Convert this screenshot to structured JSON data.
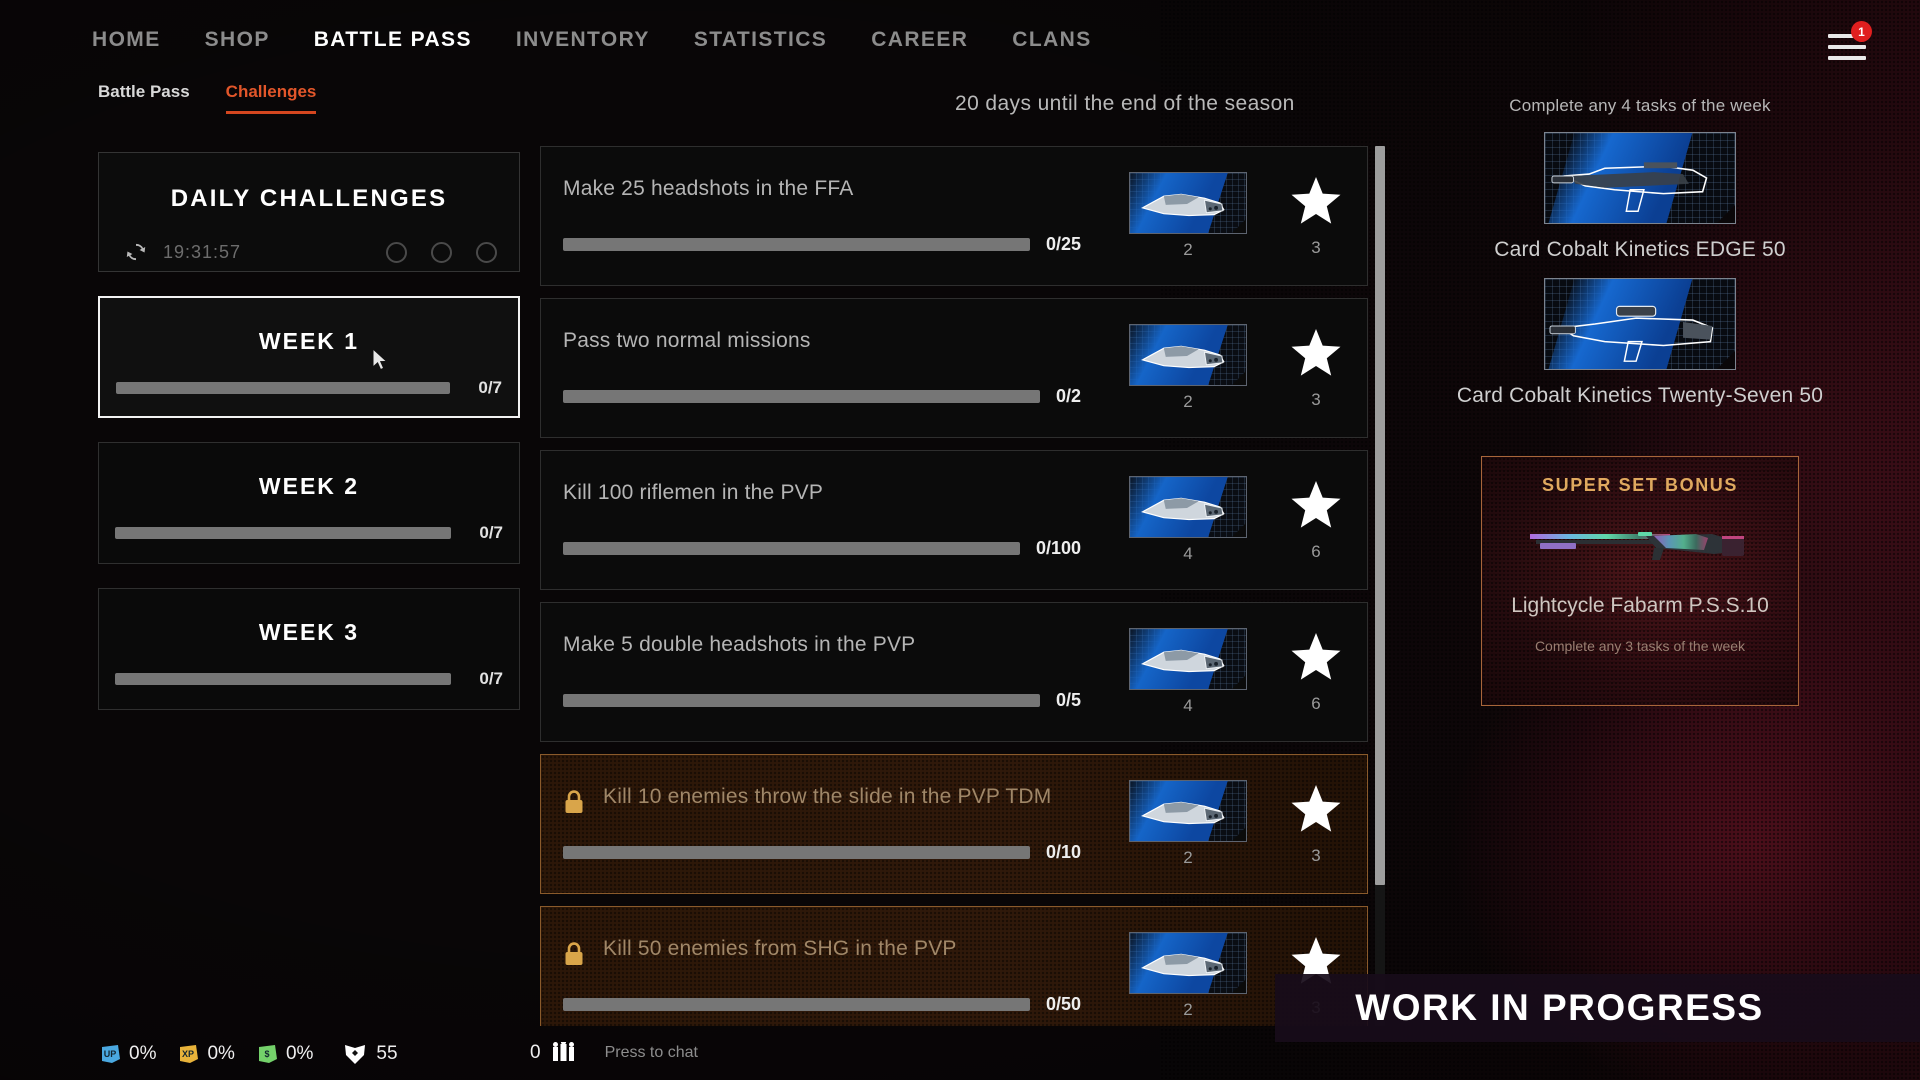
{
  "nav": {
    "items": [
      {
        "label": "HOME",
        "active": false
      },
      {
        "label": "SHOP",
        "active": false
      },
      {
        "label": "BATTLE PASS",
        "active": true
      },
      {
        "label": "INVENTORY",
        "active": false
      },
      {
        "label": "STATISTICS",
        "active": false
      },
      {
        "label": "CAREER",
        "active": false
      },
      {
        "label": "CLANS",
        "active": false
      }
    ],
    "menu_badge": "1",
    "menu_icon": "hamburger-menu-icon"
  },
  "subtabs": [
    {
      "label": "Battle Pass",
      "active": false
    },
    {
      "label": "Challenges",
      "active": true
    }
  ],
  "season": {
    "countdown_text": "20 days until the end of the season"
  },
  "daily": {
    "title": "DAILY CHALLENGES",
    "refresh_icon": "refresh-icon",
    "timer": "19:31:57",
    "slots": 3
  },
  "weeks": [
    {
      "label": "WEEK 1",
      "progress_text": "0/7",
      "percent": 0,
      "selected": true
    },
    {
      "label": "WEEK 2",
      "progress_text": "0/7",
      "percent": 0,
      "selected": false
    },
    {
      "label": "WEEK 3",
      "progress_text": "0/7",
      "percent": 0,
      "selected": false
    }
  ],
  "challenges": [
    {
      "text": "Make 25 headshots in the FFA",
      "progress_text": "0/25",
      "percent": 0,
      "locked": false,
      "card_reward": "2",
      "star_reward": "3",
      "card_icon": "knife-card-icon",
      "star_icon": "star-icon"
    },
    {
      "text": "Pass two normal missions",
      "progress_text": "0/2",
      "percent": 0,
      "locked": false,
      "card_reward": "2",
      "star_reward": "3",
      "card_icon": "knife-card-icon",
      "star_icon": "star-icon"
    },
    {
      "text": "Kill 100 riflemen in the PVP",
      "progress_text": "0/100",
      "percent": 0,
      "locked": false,
      "card_reward": "4",
      "star_reward": "6",
      "card_icon": "knife-card-icon",
      "star_icon": "star-icon"
    },
    {
      "text": "Make 5 double headshots in the PVP",
      "progress_text": "0/5",
      "percent": 0,
      "locked": false,
      "card_reward": "4",
      "star_reward": "6",
      "card_icon": "knife-card-icon",
      "star_icon": "star-icon"
    },
    {
      "text": "Kill 10 enemies throw the slide in the PVP TDM",
      "progress_text": "0/10",
      "percent": 0,
      "locked": true,
      "lock_icon": "lock-icon",
      "card_reward": "2",
      "star_reward": "3",
      "card_icon": "knife-card-icon",
      "star_icon": "star-icon"
    },
    {
      "text": "Kill 50 enemies from SHG in the PVP",
      "progress_text": "0/50",
      "percent": 0,
      "locked": true,
      "lock_icon": "lock-icon",
      "card_reward": "2",
      "star_reward": "3",
      "card_icon": "knife-card-icon",
      "star_icon": "star-icon"
    }
  ],
  "rewards": {
    "caption": "Complete any 4 tasks of the week",
    "items": [
      {
        "name": "Card Cobalt Kinetics EDGE 50",
        "icon": "rifle-card-icon"
      },
      {
        "name": "Card Cobalt Kinetics Twenty-Seven 50",
        "icon": "sniper-card-icon"
      }
    ],
    "superset": {
      "title": "SUPER SET BONUS",
      "weapon_name": "Lightcycle Fabarm P.S.S.10",
      "requirement": "Complete any 3 tasks of the week",
      "icon": "shotgun-icon"
    }
  },
  "statusbar": {
    "boosts": [
      {
        "icon": "up-boost-icon",
        "value": "0%",
        "color": "#4aa8e0"
      },
      {
        "icon": "xp-boost-icon",
        "value": "0%",
        "color": "#e8b33a"
      },
      {
        "icon": "money-boost-icon",
        "value": "0%",
        "color": "#74d16a"
      }
    ],
    "shield": {
      "icon": "shield-icon",
      "value": "55"
    },
    "players": {
      "icon": "players-icon",
      "value": "0"
    },
    "chat_hint": "Press to chat"
  },
  "overlay": {
    "wip_text": "WORK IN PROGRESS"
  },
  "colors": {
    "accent": "#e2562a",
    "locked_border": "#8a5a2b",
    "superset_title": "#e0a95f",
    "badge": "#e01f1f"
  }
}
